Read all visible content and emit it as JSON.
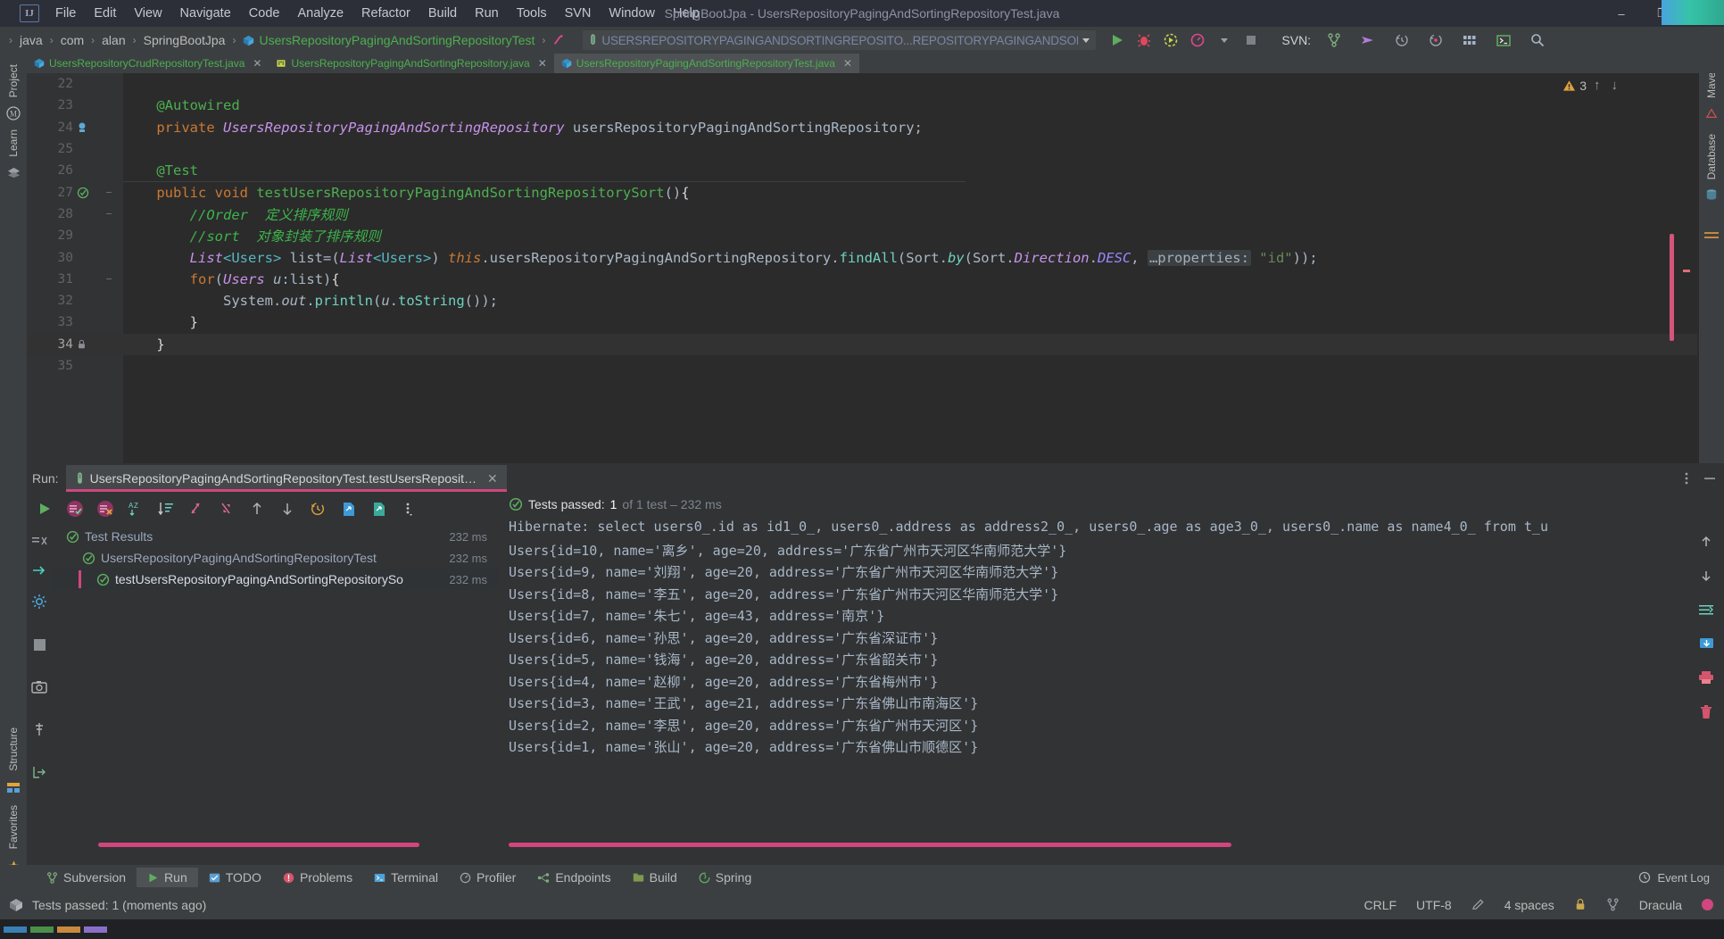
{
  "window": {
    "title": "SpringBootJpa - UsersRepositoryPagingAndSortingRepositoryTest.java",
    "minimize": "–",
    "maximize": "❐",
    "close": "✕"
  },
  "menu": {
    "items": [
      "File",
      "Edit",
      "View",
      "Navigate",
      "Code",
      "Analyze",
      "Refactor",
      "Build",
      "Run",
      "Tools",
      "SVN",
      "Window",
      "Help"
    ]
  },
  "navbar": {
    "breadcrumbs": [
      {
        "label": "java",
        "icon": "folder-icon",
        "green": false
      },
      {
        "label": "com",
        "icon": "folder-icon",
        "green": false
      },
      {
        "label": "alan",
        "icon": "folder-icon",
        "green": false
      },
      {
        "label": "SpringBootJpa",
        "icon": "folder-icon",
        "green": false
      },
      {
        "label": "UsersRepositoryPagingAndSortingRepositoryTest",
        "icon": "class-icon",
        "green": true
      }
    ],
    "trailing_icon": "method-icon",
    "run_config": "USERSREPOSITORYPAGINGANDSORTINGREPOSITO...REPOSITORYPAGINGANDSORTINGREPOSITORYSORT",
    "svn_label": "SVN:",
    "toolbar_icons": [
      "run-icon",
      "debug-icon",
      "run-with-coverage-icon",
      "profiler-icon",
      "chevron-down-icon",
      "stop-icon"
    ],
    "right_icons": [
      "vcs-branch-icon",
      "vcs-update-icon",
      "vcs-history-icon",
      "vcs-rollback-icon",
      "grid-icon",
      "terminal-icon",
      "search-icon"
    ]
  },
  "editor_tabs": [
    {
      "label": "UsersRepositoryCrudRepositoryTest.java",
      "icon": "java-class-icon",
      "active": false
    },
    {
      "label": "UsersRepositoryPagingAndSortingRepository.java",
      "icon": "interface-icon",
      "active": false
    },
    {
      "label": "UsersRepositoryPagingAndSortingRepositoryTest.java",
      "icon": "java-class-icon",
      "active": true
    }
  ],
  "left_strip": {
    "top": [
      {
        "label": "Project",
        "icon": "project-icon"
      },
      {
        "label": "Learn",
        "icon": "learn-icon"
      }
    ],
    "bottom": [
      {
        "label": "Structure",
        "icon": "structure-icon"
      },
      {
        "label": "Favorites",
        "icon": "star-icon"
      }
    ]
  },
  "right_strip": {
    "items": [
      {
        "label": "Maven",
        "icon": "maven-icon"
      },
      {
        "label": "Database",
        "icon": "database-icon"
      }
    ]
  },
  "editor": {
    "inspection_count": "3",
    "lines": [
      {
        "num": "22",
        "text": "",
        "marker": "",
        "fold": ""
      },
      {
        "num": "23",
        "text": "    @Autowired",
        "marker": "",
        "fold": ""
      },
      {
        "num": "24",
        "text": "    private UsersRepositoryPagingAndSortingRepository usersRepositoryPagingAndSortingRepository;",
        "marker": "bean-icon",
        "fold": ""
      },
      {
        "num": "25",
        "text": "",
        "marker": "",
        "fold": ""
      },
      {
        "num": "26",
        "text": "    @Test",
        "marker": "",
        "fold": ""
      },
      {
        "num": "27",
        "text": "    public void testUsersRepositoryPagingAndSortingRepositorySort(){",
        "marker": "run-test-icon",
        "fold": "−"
      },
      {
        "num": "28",
        "text": "        //Order 定义排序规则",
        "marker": "",
        "fold": "−"
      },
      {
        "num": "29",
        "text": "        //sort 对象封装了排序规则",
        "marker": "",
        "fold": ""
      },
      {
        "num": "30",
        "text": "        List<Users> list=(List<Users>) this.usersRepositoryPagingAndSortingRepository.findAll(Sort.by(Sort.Direction.DESC, …properties: \"id\"));",
        "marker": "",
        "fold": ""
      },
      {
        "num": "31",
        "text": "        for(Users u:list){",
        "marker": "",
        "fold": "−"
      },
      {
        "num": "32",
        "text": "            System.out.println(u.toString());",
        "marker": "",
        "fold": ""
      },
      {
        "num": "33",
        "text": "        }",
        "marker": "",
        "fold": ""
      },
      {
        "num": "34",
        "text": "    }",
        "marker": "lock-icon",
        "fold": ""
      },
      {
        "num": "35",
        "text": "",
        "marker": "",
        "fold": ""
      }
    ],
    "current_line": "34"
  },
  "run_panel": {
    "label": "Run:",
    "tab_title": "UsersRepositoryPagingAndSortingRepositoryTest.testUsersReposit…",
    "tab_icon": "test-tube-icon",
    "tab_close": "✕",
    "toolbar_icons": [
      "rerun-icon",
      "show-passed-icon",
      "hide-passed-icon",
      "sort-alpha-icon",
      "sort-duration-icon",
      "expand-all-icon",
      "collapse-all-icon",
      "prev-failed-icon",
      "next-failed-icon",
      "history-icon",
      "import-tests-icon",
      "export-tests-icon",
      "more-options-icon"
    ],
    "status": {
      "icon": "check-circle-icon",
      "main": "Tests passed:",
      "count": "1",
      "dim": " of 1 test – 232 ms"
    },
    "header_right": [
      "more-vertical-icon",
      "minimize-icon"
    ],
    "tree": [
      {
        "label": "Test Results",
        "time": "232 ms",
        "indent": 0,
        "icon": "check-circle-icon",
        "chevron": "ⱟ",
        "selected": false
      },
      {
        "label": "UsersRepositoryPagingAndSortingRepositoryTest",
        "time": "232 ms",
        "indent": 1,
        "icon": "check-circle-icon",
        "chevron": "ⱟ",
        "selected": false
      },
      {
        "label": "testUsersRepositoryPagingAndSortingRepositorySo",
        "time": "232 ms",
        "indent": 2,
        "icon": "check-circle-icon",
        "chevron": "",
        "selected": true
      }
    ],
    "left_strip_icons": [
      "hide-icon",
      "rerun-failed-icon",
      "settings-gear-icon",
      "stop-square-icon",
      "screenshot-icon",
      "thread-dump-icon",
      "exit-icon"
    ],
    "right_strip_icons": [
      "scroll-up-icon",
      "scroll-down-icon",
      "soft-wrap-icon",
      "scroll-to-end-icon",
      "print-icon",
      "trash-icon"
    ],
    "console": [
      "Hibernate: select users0_.id as id1_0_, users0_.address as address2_0_, users0_.age as age3_0_, users0_.name as name4_0_ from t_u",
      "Users{id=10, name='离乡', age=20, address='广东省广州市天河区华南师范大学'}",
      "Users{id=9, name='刘翔', age=20, address='广东省广州市天河区华南师范大学'}",
      "Users{id=8, name='李五', age=20, address='广东省广州市天河区华南师范大学'}",
      "Users{id=7, name='朱七', age=43, address='南京'}",
      "Users{id=6, name='孙思', age=20, address='广东省深证市'}",
      "Users{id=5, name='钱海', age=20, address='广东省韶关市'}",
      "Users{id=4, name='赵柳', age=20, address='广东省梅州市'}",
      "Users{id=3, name='王武', age=21, address='广东省佛山市南海区'}",
      "Users{id=2, name='李思', age=20, address='广东省广州市天河区'}",
      "Users{id=1, name='张山', age=20, address='广东省佛山市顺德区'}"
    ]
  },
  "bottom_bar": {
    "items": [
      {
        "label": "Subversion",
        "icon": "vcs-branch-icon",
        "active": false
      },
      {
        "label": "Run",
        "icon": "run-icon",
        "active": true
      },
      {
        "label": "TODO",
        "icon": "todo-icon",
        "active": false
      },
      {
        "label": "Problems",
        "icon": "problems-icon",
        "active": false
      },
      {
        "label": "Terminal",
        "icon": "terminal-icon",
        "active": false
      },
      {
        "label": "Profiler",
        "icon": "profiler-icon",
        "active": false
      },
      {
        "label": "Endpoints",
        "icon": "endpoints-icon",
        "active": false
      },
      {
        "label": "Build",
        "icon": "build-icon",
        "active": false
      },
      {
        "label": "Spring",
        "icon": "spring-icon",
        "active": false
      }
    ],
    "event_log": "Event Log",
    "event_log_icon": "event-log-icon"
  },
  "status_bar": {
    "message": "Tests passed: 1 (moments ago)",
    "message_icon": "package-icon",
    "line_sep": "CRLF",
    "encoding": "UTF-8",
    "indent": "4 spaces",
    "theme": "Dracula",
    "lock_icon": "lock-icon",
    "pencil_icon": "pencil-icon",
    "theme_dot_color": "#d1467f"
  }
}
